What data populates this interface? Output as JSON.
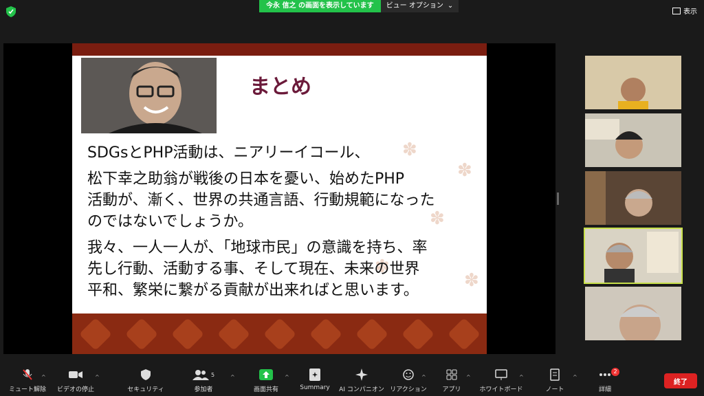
{
  "share_banner": {
    "name": "今永 信之 の画面を表示しています",
    "view_options": "ビュー オプション",
    "caret": "⌄"
  },
  "display_label": "表示",
  "slide": {
    "title": "まとめ",
    "paragraphs": [
      [
        "SDGsとPHP活動は、ニアリーイコール、"
      ],
      [
        "松下幸之助翁が戦後の日本を憂い、始めたPHP",
        "活動が、漸く、世界の共通言語、行動規範になった",
        "のではないでしょうか。"
      ],
      [
        "我々、一人一人が、「地球市民」の意識を持ち、率",
        "先し行動、活動する事、そして現在、未来の世界",
        "平和、繁栄に繋がる貢献が出来ればと思います。"
      ]
    ]
  },
  "participants": [
    "participant-1",
    "participant-2",
    "participant-3",
    "participant-4",
    "participant-5"
  ],
  "toolbar": {
    "mute": "ミュート解除",
    "video": "ビデオの停止",
    "security": "セキュリティ",
    "participants": "参加者",
    "participants_count": "5",
    "share": "画面共有",
    "summary": "Summary",
    "ai": "AI コンパニオン",
    "reactions": "リアクション",
    "apps": "アプリ",
    "whiteboard": "ホワイトボード",
    "notes": "ノート",
    "more": "詳細",
    "more_badge": "2",
    "end": "終了"
  },
  "colors": {
    "share_green": "#23c24a",
    "end_red": "#dd2222",
    "slide_title": "#6b1a3a",
    "slide_band": "#7a1d10",
    "active_outline": "#c8e04a"
  }
}
